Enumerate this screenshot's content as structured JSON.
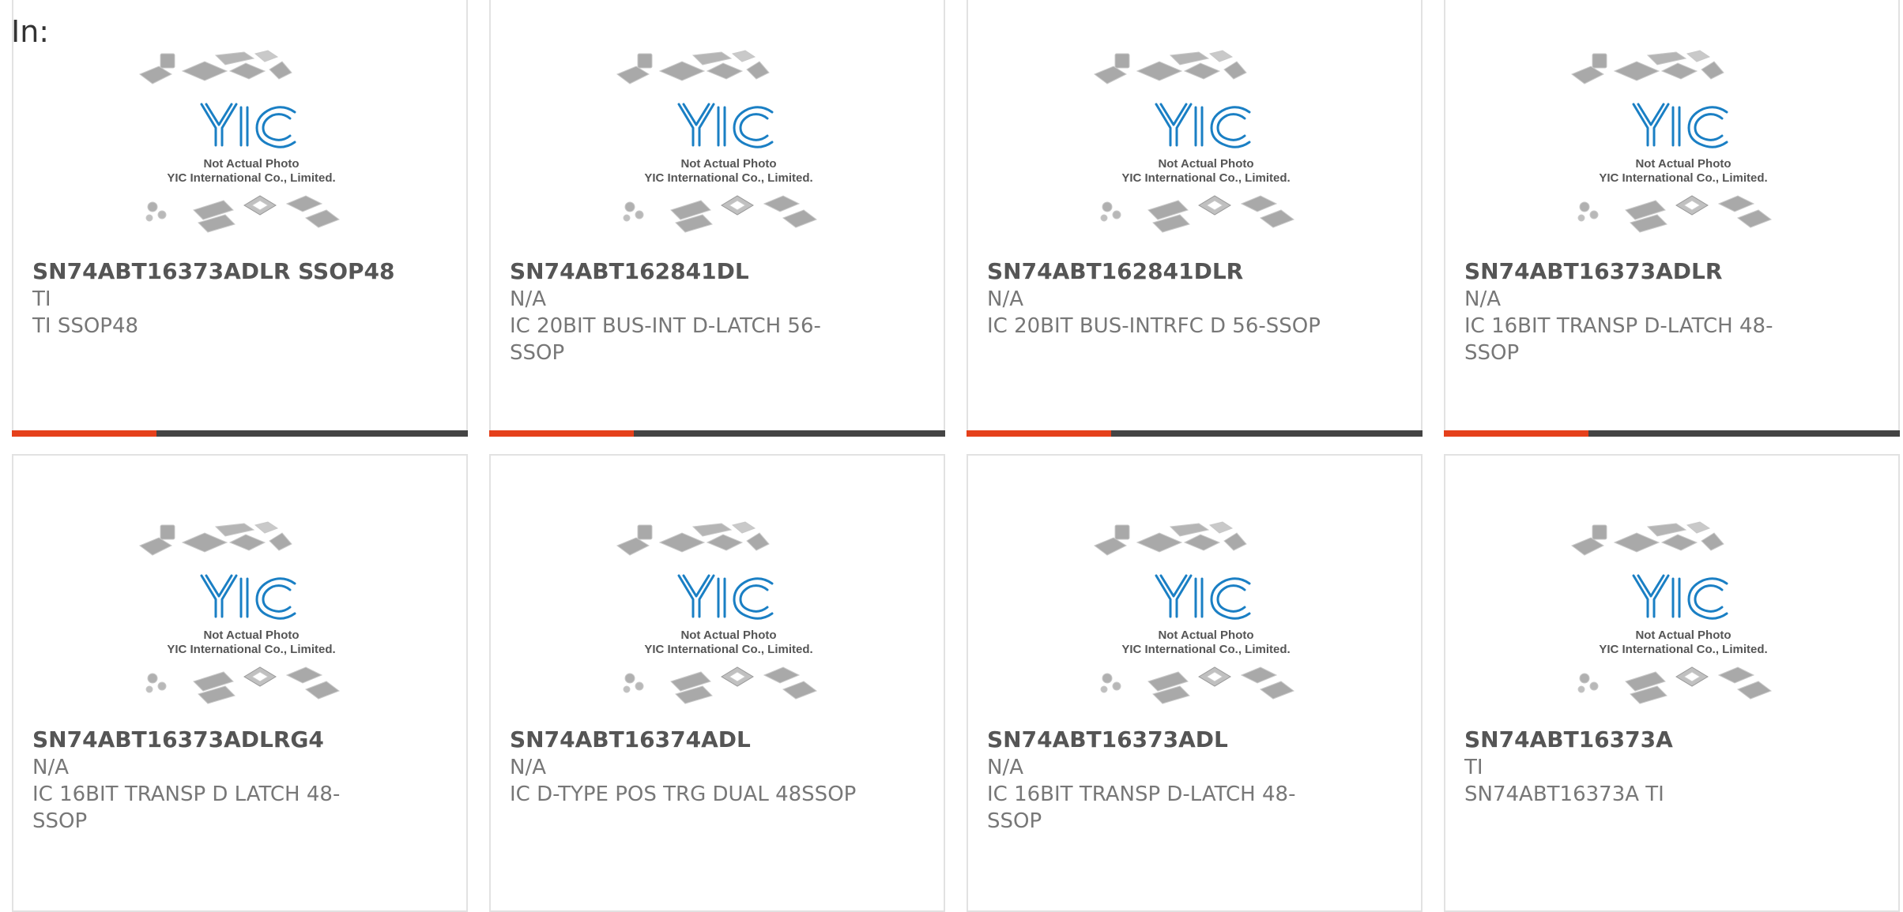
{
  "header": {
    "label": "In:"
  },
  "thumbnail": {
    "caption_line1": "Not Actual Photo",
    "caption_line2": "YIC International Co., Limited.",
    "logo_text": "YIC"
  },
  "colors": {
    "accent": "#e5401b",
    "bar": "#444444",
    "logo": "#1a7fc4"
  },
  "products": [
    {
      "part": "SN74ABT16373ADLR SSOP48",
      "mfr": "TI",
      "desc": "TI SSOP48"
    },
    {
      "part": "SN74ABT162841DL",
      "mfr": "N/A",
      "desc": "IC 20BIT BUS-INT D-LATCH 56-SSOP"
    },
    {
      "part": "SN74ABT162841DLR",
      "mfr": "N/A",
      "desc": "IC 20BIT BUS-INTRFC D 56-SSOP"
    },
    {
      "part": "SN74ABT16373ADLR",
      "mfr": "N/A",
      "desc": "IC 16BIT TRANSP D-LATCH 48-SSOP"
    },
    {
      "part": "SN74ABT16373ADLRG4",
      "mfr": "N/A",
      "desc": "IC 16BIT TRANSP D LATCH 48-SSOP"
    },
    {
      "part": "SN74ABT16374ADL",
      "mfr": "N/A",
      "desc": "IC D-TYPE POS TRG DUAL 48SSOP"
    },
    {
      "part": "SN74ABT16373ADL",
      "mfr": "N/A",
      "desc": "IC 16BIT TRANSP D-LATCH 48-SSOP"
    },
    {
      "part": "SN74ABT16373A",
      "mfr": "TI",
      "desc": "SN74ABT16373A TI"
    }
  ]
}
